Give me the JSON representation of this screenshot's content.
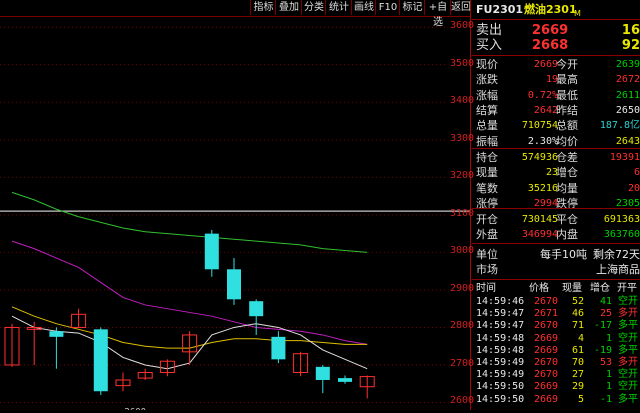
{
  "toolbar": {
    "buttons": [
      "指标",
      "叠加",
      "分类",
      "统计",
      "画线",
      "F10",
      "标记",
      "+自选",
      "返回"
    ]
  },
  "instrument": {
    "code": "FU2301",
    "name": "燃油2301",
    "suffix": "M"
  },
  "quotes": {
    "sell": {
      "label": "卖出",
      "price": "2669",
      "vol": "16"
    },
    "buy": {
      "label": "买入",
      "price": "2668",
      "vol": "92"
    }
  },
  "stats": [
    {
      "l1": "现价",
      "v1": "2669",
      "c1": "red",
      "l2": "今开",
      "v2": "2639",
      "c2": "green"
    },
    {
      "l1": "涨跌",
      "v1": "19",
      "c1": "red",
      "l2": "最高",
      "v2": "2672",
      "c2": "red"
    },
    {
      "l1": "涨幅",
      "v1": "0.72%",
      "c1": "red",
      "l2": "最低",
      "v2": "2611",
      "c2": "green"
    },
    {
      "l1": "结算",
      "v1": "2642",
      "c1": "red",
      "l2": "昨结",
      "v2": "2650",
      "c2": "white"
    },
    {
      "l1": "总量",
      "v1": "710754",
      "c1": "yellow",
      "l2": "总额",
      "v2": "187.8亿",
      "c2": "cyan"
    },
    {
      "l1": "振幅",
      "v1": "2.30%",
      "c1": "white",
      "l2": "均价",
      "v2": "2643",
      "c2": "yellow"
    }
  ],
  "stats2": [
    {
      "l1": "持仓",
      "v1": "574936",
      "c1": "yellow",
      "l2": "仓差",
      "v2": "19391",
      "c2": "red"
    },
    {
      "l1": "现量",
      "v1": "23",
      "c1": "yellow",
      "l2": "增仓",
      "v2": "6",
      "c2": "red"
    },
    {
      "l1": "笔数",
      "v1": "35216",
      "c1": "yellow",
      "l2": "均量",
      "v2": "20",
      "c2": "red"
    },
    {
      "l1": "涨停",
      "v1": "2994",
      "c1": "red",
      "l2": "跌停",
      "v2": "2305",
      "c2": "green"
    }
  ],
  "stats3": [
    {
      "l1": "开仓",
      "v1": "730145",
      "c1": "yellow",
      "l2": "平仓",
      "v2": "691363",
      "c2": "yellow"
    },
    {
      "l1": "外盘",
      "v1": "346994",
      "c1": "red",
      "l2": "内盘",
      "v2": "363760",
      "c2": "green"
    }
  ],
  "info": {
    "unit_label": "单位",
    "unit_value": "每手10吨",
    "remain": "剩余72天",
    "market_label": "市场",
    "market_value": "上海商品"
  },
  "ticks_header": [
    "时间",
    "价格",
    "现量",
    "增仓",
    "开平"
  ],
  "ticks": [
    {
      "t": "14:59:46",
      "p": "2670",
      "v": "52",
      "d": "41",
      "k": "空开",
      "dc": "green",
      "kc": "green"
    },
    {
      "t": "14:59:47",
      "p": "2671",
      "v": "46",
      "d": "25",
      "k": "多开",
      "dc": "red",
      "kc": "red"
    },
    {
      "t": "14:59:47",
      "p": "2670",
      "v": "71",
      "d": "-17",
      "k": "多平",
      "dc": "green",
      "kc": "green"
    },
    {
      "t": "14:59:48",
      "p": "2669",
      "v": "4",
      "d": "1",
      "k": "空开",
      "dc": "green",
      "kc": "green"
    },
    {
      "t": "14:59:48",
      "p": "2669",
      "v": "61",
      "d": "-19",
      "k": "多平",
      "dc": "green",
      "kc": "green"
    },
    {
      "t": "14:59:49",
      "p": "2670",
      "v": "70",
      "d": "53",
      "k": "多开",
      "dc": "red",
      "kc": "red"
    },
    {
      "t": "14:59:49",
      "p": "2670",
      "v": "27",
      "d": "1",
      "k": "空开",
      "dc": "green",
      "kc": "green"
    },
    {
      "t": "14:59:50",
      "p": "2669",
      "v": "29",
      "d": "1",
      "k": "空开",
      "dc": "green",
      "kc": "green"
    },
    {
      "t": "14:59:50",
      "p": "2669",
      "v": "5",
      "d": "-1",
      "k": "多平",
      "dc": "green",
      "kc": "green"
    }
  ],
  "chart_data": {
    "type": "candlestick",
    "ylim": [
      2580,
      3630
    ],
    "yticks": [
      "3600",
      "3500",
      "3400",
      "3300",
      "3200",
      "3100",
      "3000",
      "2900",
      "2800",
      "2700",
      "2600"
    ],
    "reference_line": 3110,
    "low_marker": "2600",
    "candles": [
      {
        "o": 2700,
        "c": 2800,
        "h": 2810,
        "l": 2695
      },
      {
        "o": 2795,
        "c": 2800,
        "h": 2815,
        "l": 2700
      },
      {
        "o": 2790,
        "c": 2775,
        "h": 2800,
        "l": 2690
      },
      {
        "o": 2800,
        "c": 2835,
        "h": 2850,
        "l": 2800
      },
      {
        "o": 2795,
        "c": 2630,
        "h": 2800,
        "l": 2620
      },
      {
        "o": 2645,
        "c": 2660,
        "h": 2680,
        "l": 2630
      },
      {
        "o": 2665,
        "c": 2680,
        "h": 2690,
        "l": 2660
      },
      {
        "o": 2680,
        "c": 2710,
        "h": 2715,
        "l": 2670
      },
      {
        "o": 2735,
        "c": 2780,
        "h": 2790,
        "l": 2700
      },
      {
        "o": 3050,
        "c": 2955,
        "h": 3060,
        "l": 2935
      },
      {
        "o": 2955,
        "c": 2875,
        "h": 2985,
        "l": 2860
      },
      {
        "o": 2870,
        "c": 2830,
        "h": 2875,
        "l": 2780
      },
      {
        "o": 2775,
        "c": 2715,
        "h": 2790,
        "l": 2705
      },
      {
        "o": 2680,
        "c": 2730,
        "h": 2735,
        "l": 2670
      },
      {
        "o": 2695,
        "c": 2660,
        "h": 2700,
        "l": 2625
      },
      {
        "o": 2665,
        "c": 2655,
        "h": 2672,
        "l": 2650
      },
      {
        "o": 2642,
        "c": 2669,
        "h": 2672,
        "l": 2611
      }
    ],
    "ma_series": [
      {
        "color": "#30c030",
        "values": [
          3160,
          3140,
          3115,
          3095,
          3080,
          3065,
          3055,
          3050,
          3045,
          3040,
          3035,
          3030,
          3025,
          3020,
          3010,
          3005,
          3000
        ]
      },
      {
        "color": "#c020c0",
        "values": [
          3030,
          3010,
          2985,
          2960,
          2920,
          2880,
          2860,
          2850,
          2840,
          2830,
          2815,
          2800,
          2795,
          2790,
          2780,
          2765,
          2755
        ]
      },
      {
        "color": "#e0c000",
        "values": [
          2855,
          2830,
          2810,
          2795,
          2780,
          2760,
          2750,
          2745,
          2745,
          2760,
          2770,
          2770,
          2765,
          2765,
          2760,
          2755,
          2755
        ]
      },
      {
        "color": "#e0e0e0",
        "values": [
          2830,
          2800,
          2790,
          2785,
          2760,
          2720,
          2700,
          2690,
          2705,
          2780,
          2800,
          2810,
          2800,
          2780,
          2740,
          2715,
          2690
        ]
      }
    ]
  }
}
